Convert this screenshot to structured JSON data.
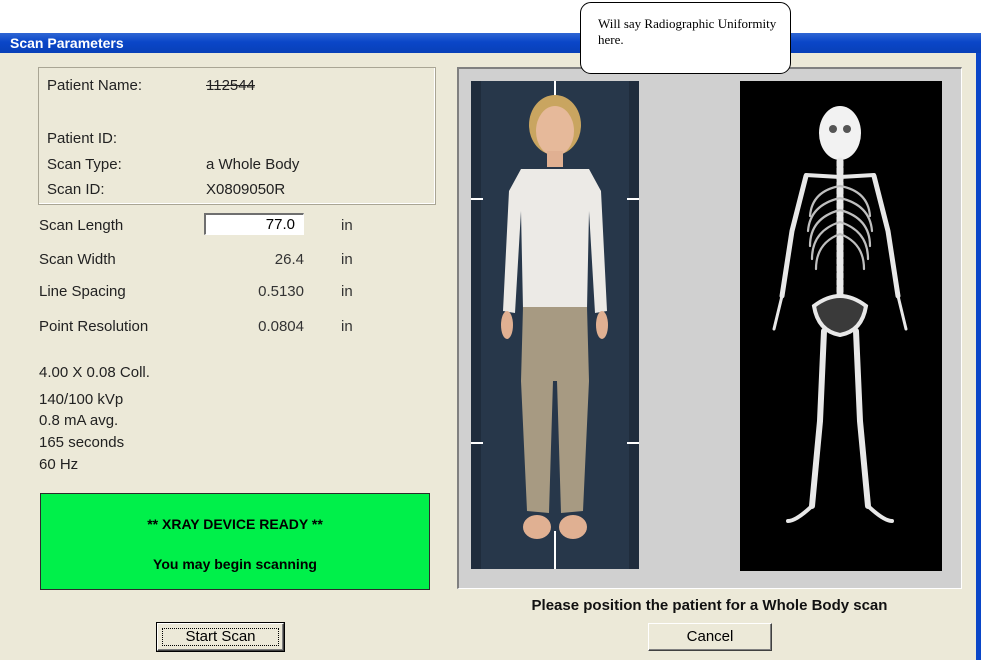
{
  "window": {
    "title": "Scan Parameters"
  },
  "callout": {
    "text": "Will say Radiographic Uniformity here."
  },
  "patient": {
    "name_label": "Patient Name:",
    "name_value": "112544",
    "id_label": "Patient ID:",
    "id_value": "",
    "scan_type_label": "Scan Type:",
    "scan_type_value": "a Whole Body",
    "scan_id_label": "Scan ID:",
    "scan_id_value": "X0809050R"
  },
  "params": {
    "scan_length_label": "Scan Length",
    "scan_length_value": "77.0",
    "scan_length_unit": "in",
    "scan_width_label": "Scan Width",
    "scan_width_value": "26.4",
    "scan_width_unit": "in",
    "line_spacing_label": "Line Spacing",
    "line_spacing_value": "0.5130",
    "line_spacing_unit": "in",
    "point_resolution_label": "Point Resolution",
    "point_resolution_value": "0.0804",
    "point_resolution_unit": "in"
  },
  "technique": {
    "collimation": "4.00 X 0.08 Coll.",
    "kvp": "140/100 kVp",
    "ma": "0.8 mA avg.",
    "seconds": "165 seconds",
    "hz": "60 Hz"
  },
  "status": {
    "line1": "** XRAY DEVICE READY **",
    "line2": "You may begin scanning",
    "color": "#00f04a"
  },
  "footer": {
    "message": "Please position the patient for a Whole Body scan"
  },
  "buttons": {
    "start": "Start Scan",
    "cancel": "Cancel"
  },
  "colors": {
    "titlebar": "#0a46c8",
    "window_bg": "#ece9d8"
  }
}
